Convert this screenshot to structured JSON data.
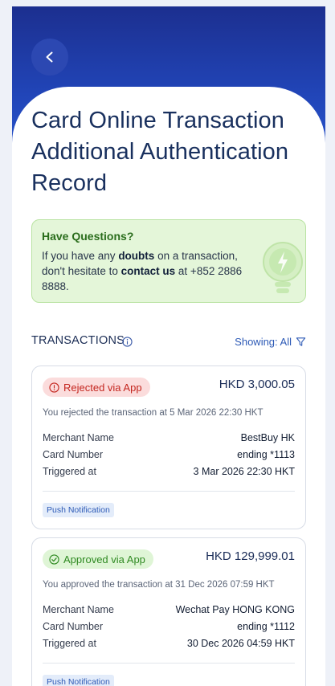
{
  "header": {
    "back_icon": "chevron-left-icon",
    "title": "Card Online Transaction Additional Authentication Record"
  },
  "help": {
    "title": "Have Questions?",
    "text_1": "If you have any ",
    "text_bold_1": "doubts",
    "text_2": " on a transaction, don't hesitate to ",
    "link": "contact us",
    "text_3": " at +852 2886 8888.",
    "icon": "lightbulb-icon"
  },
  "transactions": {
    "heading": "TRANSACTIONS",
    "info_icon": "info-icon",
    "filter_label": "Showing: All",
    "filter_icon": "filter-icon",
    "labels": {
      "merchant": "Merchant Name",
      "card": "Card Number",
      "triggered": "Triggered at"
    },
    "items": [
      {
        "status": "Rejected via App",
        "status_icon": "alert-circle-icon",
        "amount": "HKD 3,000.05",
        "description": "You rejected the transaction at 5 Mar 2026 22:30 HKT",
        "merchant": "BestBuy HK",
        "card": "ending *1113",
        "triggered": "3 Mar 2026 22:30 HKT",
        "tag": "Push Notification"
      },
      {
        "status": "Approved via App",
        "status_icon": "check-circle-icon",
        "amount": "HKD 129,999.01",
        "description": "You approved the transaction at 31 Dec 2026 07:59 HKT",
        "merchant": "Wechat Pay HONG KONG",
        "card": "ending *1112",
        "triggered": "30 Dec 2026 04:59 HKT",
        "tag": "Push Notification"
      }
    ]
  },
  "colors": {
    "header_blue": "#1c2f8f",
    "rejected": "#c4261f",
    "approved": "#2f8a22",
    "link_blue": "#2d5ab6"
  }
}
